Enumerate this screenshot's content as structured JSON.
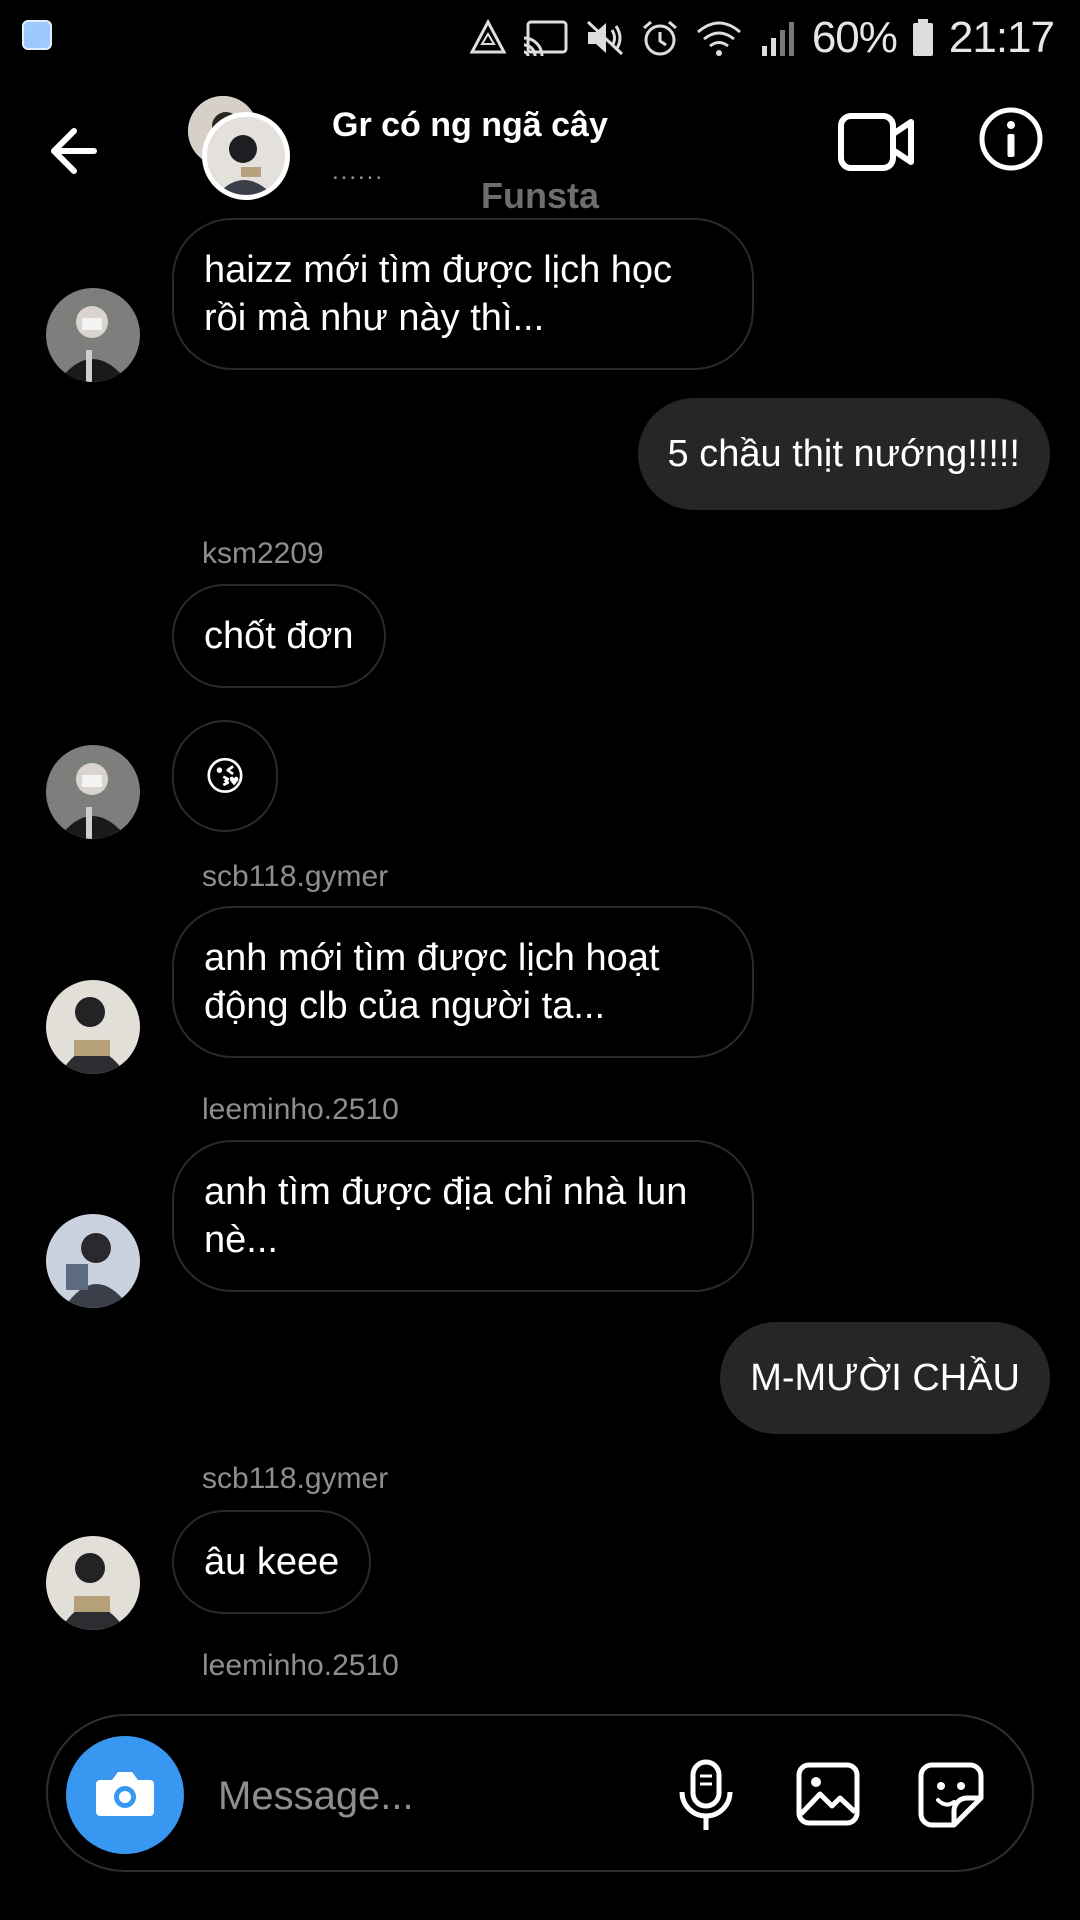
{
  "status_bar": {
    "battery": "60%",
    "time": "21:17",
    "icons": [
      "recycle-icon",
      "cast-icon",
      "mute-icon",
      "alarm-icon",
      "wifi-icon",
      "signal-icon",
      "battery-icon"
    ]
  },
  "header": {
    "title": "Gr có ng ngã cây",
    "subtitle": "......",
    "account_label": "Funsta"
  },
  "messages": [
    {
      "direction": "in",
      "text": "haizz mới tìm được lịch học rồi mà như này thì..."
    },
    {
      "direction": "out",
      "text": "5 chầu thịt nướng!!!!!"
    },
    {
      "direction": "in",
      "sender": "ksm2209",
      "text": "chốt đơn"
    },
    {
      "direction": "in",
      "text": "😘"
    },
    {
      "direction": "in",
      "sender": "scb118.gymer",
      "text": "anh mới tìm được lịch hoạt động clb của người ta..."
    },
    {
      "direction": "in",
      "sender": "leeminho.2510",
      "text": "anh tìm được địa chỉ nhà lun nè..."
    },
    {
      "direction": "out",
      "text": "M-MƯỜI CHẦU"
    },
    {
      "direction": "in",
      "sender": "scb118.gymer",
      "text": "âu keee"
    },
    {
      "direction": "in",
      "sender": "leeminho.2510",
      "text": ""
    }
  ],
  "composer": {
    "placeholder": "Message..."
  },
  "colors": {
    "background": "#000000",
    "outgoing_bubble": "#262626",
    "incoming_border": "#2a2a2a",
    "camera_button": "#3897f0",
    "muted_text": "#8e8e8e"
  }
}
